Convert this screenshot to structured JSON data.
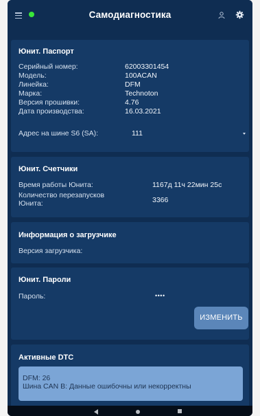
{
  "header": {
    "title": "Самодиагностика",
    "status_color": "#39e639",
    "icons": [
      "menu-icon",
      "status-dot",
      "user-icon",
      "gear-icon"
    ]
  },
  "passport": {
    "title": "Юнит. Паспорт",
    "rows": [
      {
        "label": "Серийный номер:",
        "value": "62003301454"
      },
      {
        "label": "Модель:",
        "value": "100ACAN"
      },
      {
        "label": "Линейка:",
        "value": "DFM"
      },
      {
        "label": "Марка:",
        "value": "Technoton"
      },
      {
        "label": "Версия прошивки:",
        "value": "4.76"
      },
      {
        "label": "Дата производства:",
        "value": "16.03.2021"
      }
    ],
    "bus_address_label": "Адрес на шине S6 (SA):",
    "bus_address_value": "111"
  },
  "counters": {
    "title": "Юнит. Счетчики",
    "uptime_label": "Время работы Юнита:",
    "uptime_value": "1167д 11ч 22мин 25с",
    "restarts_label_line1": "Количество перезапусков",
    "restarts_label_line2": "Юнита:",
    "restarts_value": "3366"
  },
  "bootloader": {
    "title": "Информация о загрузчике",
    "version_label": "Версия загрузчика:"
  },
  "passwords": {
    "title": "Юнит. Пароли",
    "password_label": "Пароль:",
    "password_value": "••••",
    "change_button": "ИЗМЕНИТЬ"
  },
  "dtc": {
    "title": "Активные DTC",
    "line1": "DFM: 26",
    "line2": "Шина CAN B: Данные ошибочны или некорректны"
  },
  "colors": {
    "background": "#0f2d52",
    "card": "#153a66",
    "button": "#5b86b9",
    "dtc_box": "#7ba5d6"
  }
}
